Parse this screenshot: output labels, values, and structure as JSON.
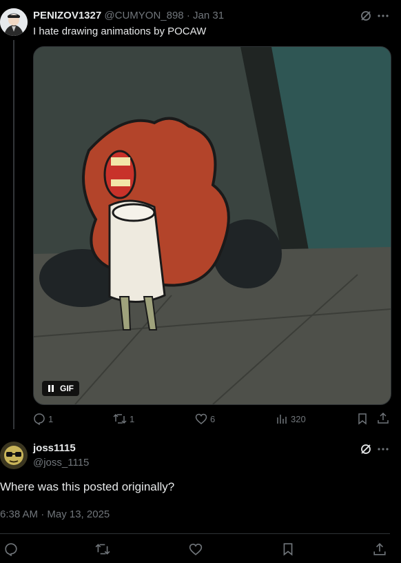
{
  "post": {
    "display_name": "PENIZOV1327",
    "handle": "@CUMYON_898",
    "separator": "·",
    "date": "Jan 31",
    "text": "I hate drawing animations by POCAW",
    "gif_label": "GIF",
    "actions": {
      "replies": "1",
      "reposts": "1",
      "likes": "6",
      "views": "320"
    }
  },
  "reply": {
    "display_name": "joss1115",
    "handle": "@joss_1115",
    "text": "Where was this posted originally?",
    "timestamp": "6:38 AM · May 13, 2025"
  },
  "icons": {
    "grok": "grok-icon",
    "more": "more-icon",
    "reply": "reply-icon",
    "repost": "repost-icon",
    "like": "heart-icon",
    "views": "views-icon",
    "bookmark": "bookmark-icon",
    "share": "share-icon",
    "pause": "pause-icon"
  },
  "colors": {
    "background": "#000000",
    "text": "#e7e9ea",
    "muted": "#71767b",
    "divider": "#2f3336"
  }
}
